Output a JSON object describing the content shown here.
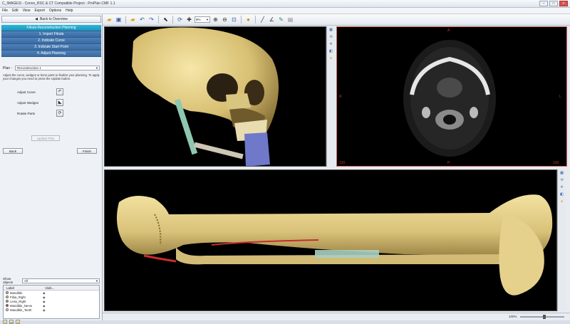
{
  "window": {
    "title": "C_IMAGES\\ - Convo_RSC & CT Compatible Project - ProPlan CMF 1.1",
    "controls": {
      "minimize": "–",
      "maximize": "□",
      "close": "×"
    }
  },
  "menu": [
    "File",
    "Edit",
    "View",
    "Export",
    "Options",
    "Help"
  ],
  "left_panel": {
    "back_label": "Back to Overview",
    "steps": [
      {
        "label": "Fibula Reconstruction Planning",
        "active": true
      },
      {
        "label": "1. Import Fibula",
        "active": false
      },
      {
        "label": "2. Indicate Curve",
        "active": false
      },
      {
        "label": "3. Indicate Start Point",
        "active": false
      },
      {
        "label": "4. Adjust Planning",
        "active": false
      }
    ],
    "plan_label": "Plan :",
    "plan_value": "Reconstruction 1",
    "hint": "Adjust the curve, wedges or bone parts to finalize your planning. To apply your changes you need to press the Update button.",
    "tools": [
      {
        "label": "Adjust Curve",
        "icon": "curve-icon"
      },
      {
        "label": "Adjust Wedges",
        "icon": "wedge-icon"
      },
      {
        "label": "Rotate Parts",
        "icon": "rotate-icon"
      }
    ],
    "update_label": "Update Plan",
    "back_btn": "Back",
    "finish_btn": "Finish",
    "show_objects_label": "Show objects",
    "show_objects_value": "All",
    "object_columns": [
      "Label",
      "Visib..."
    ],
    "objects": [
      {
        "name": "Mandible",
        "color": "#d9c27a"
      },
      {
        "name": "Fibia_Right",
        "color": "#e8d9a0"
      },
      {
        "name": "Leiss_Right",
        "color": "#c9b06a"
      },
      {
        "name": "Mandible_Nerve",
        "color": "#d23a3a"
      },
      {
        "name": "Mandible_Teeth",
        "color": "#eeeeee"
      }
    ]
  },
  "toolbar": {
    "zoom_value": "8%"
  },
  "ct_view": {
    "top": "A",
    "left": "R",
    "right": "L",
    "bottom": "P",
    "corner_left": "120",
    "corner_right": "120"
  },
  "status": {
    "zoom_label": "100%",
    "zoom_level": 0.55
  }
}
